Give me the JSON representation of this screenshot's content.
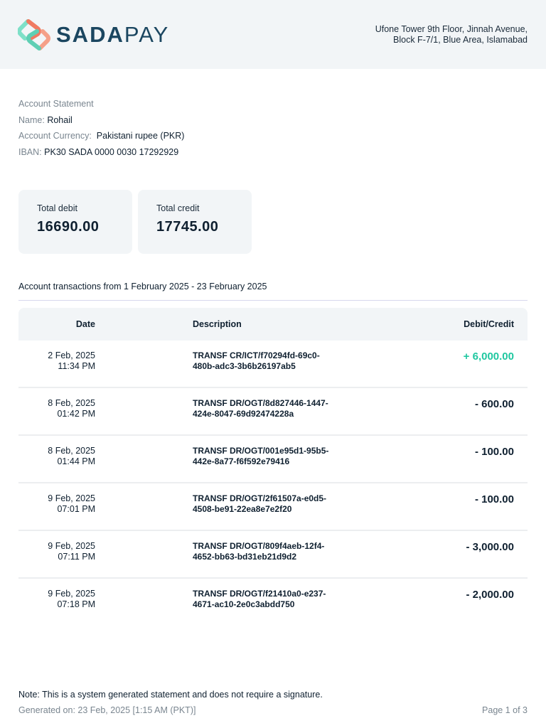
{
  "header": {
    "brand_bold": "SADA",
    "brand_light": "PAY",
    "address_line1": "Ufone Tower 9th Floor, Jinnah Avenue,",
    "address_line2": "Block F-7/1, Blue Area, Islamabad"
  },
  "info": {
    "title": "Account Statement",
    "name_label": "Name:",
    "name": "Rohail",
    "currency_label": "Account Currency:",
    "currency": "Pakistani rupee (PKR)",
    "iban_label": "IBAN:",
    "iban": "PK30 SADA 0000 0030 17292929"
  },
  "totals": {
    "debit_label": "Total debit",
    "debit": "16690.00",
    "credit_label": "Total credit",
    "credit": "17745.00"
  },
  "range": "Account transactions from 1 February 2025 - 23 February 2025",
  "table": {
    "headers": [
      "Date",
      "Description",
      "Debit/Credit"
    ],
    "rows": [
      {
        "date": "2 Feb, 2025",
        "time": "11:34 PM",
        "desc1": "TRANSF CR/ICT/f70294fd-69c0-",
        "desc2": "480b-adc3-3b6b26197ab5",
        "amount": "+ 6,000.00",
        "type": "credit"
      },
      {
        "date": "8 Feb, 2025",
        "time": "01:42 PM",
        "desc1": "TRANSF DR/OGT/8d827446-1447-",
        "desc2": "424e-8047-69d92474228a",
        "amount": "- 600.00",
        "type": "debit"
      },
      {
        "date": "8 Feb, 2025",
        "time": "01:44 PM",
        "desc1": "TRANSF DR/OGT/001e95d1-95b5-",
        "desc2": "442e-8a77-f6f592e79416",
        "amount": "- 100.00",
        "type": "debit"
      },
      {
        "date": "9 Feb, 2025",
        "time": "07:01 PM",
        "desc1": "TRANSF DR/OGT/2f61507a-e0d5-",
        "desc2": "4508-be91-22ea8e7e2f20",
        "amount": "- 100.00",
        "type": "debit"
      },
      {
        "date": "9 Feb, 2025",
        "time": "07:11 PM",
        "desc1": "TRANSF DR/OGT/809f4aeb-12f4-",
        "desc2": "4652-bb63-bd31eb21d9d2",
        "amount": "- 3,000.00",
        "type": "debit"
      },
      {
        "date": "9 Feb, 2025",
        "time": "07:18 PM",
        "desc1": "TRANSF DR/OGT/f21410a0-e237-",
        "desc2": "4671-ac10-2e0c3abdd750",
        "amount": "- 2,000.00",
        "type": "debit"
      }
    ]
  },
  "footer": {
    "note": "Note: This is a system generated statement and does not require a signature.",
    "generated": "Generated on: 23 Feb, 2025 [1:15 AM (PKT)]",
    "page": "Page 1 of 3"
  },
  "colors": {
    "credit": "#1fc7a0",
    "brand": "#1b4660"
  }
}
